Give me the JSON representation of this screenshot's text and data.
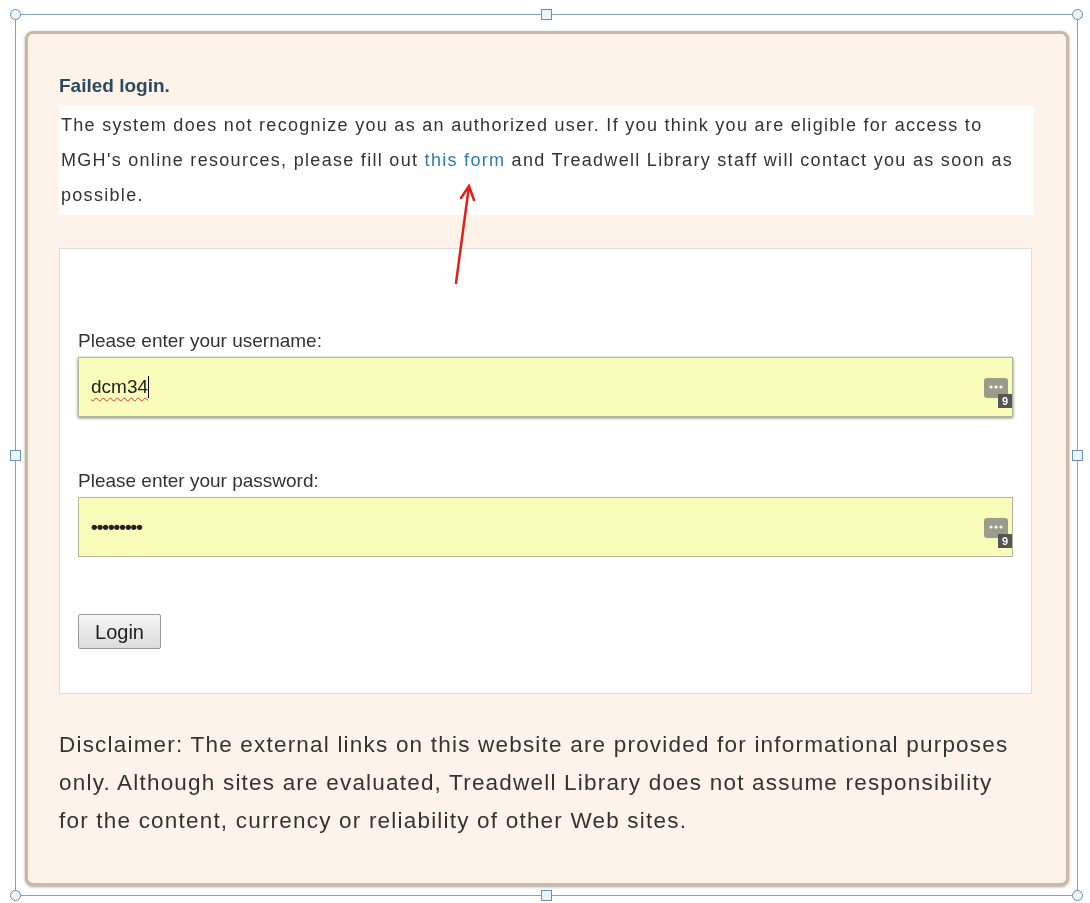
{
  "heading": "Failed login.",
  "message": {
    "before": "The system does not recognize you as an authorized user. If you think you are eligible for access to MGH's online resources, please fill out ",
    "link": "this form",
    "after": " and Treadwell Library staff will contact you as soon as possible."
  },
  "fields": [
    {
      "label": "Please enter your username:",
      "value": "dcm34",
      "kind": "text",
      "badge": "9"
    },
    {
      "label": "Please enter your password:",
      "value": "•••••••••",
      "kind": "password",
      "badge": "9"
    }
  ],
  "button": "Login",
  "disclaimer": "Disclaimer: The external links on this website are provided for informational purposes only. Although sites are evaluated, Treadwell Library does not assume responsibility for the content, currency or reliability of other Web sites."
}
